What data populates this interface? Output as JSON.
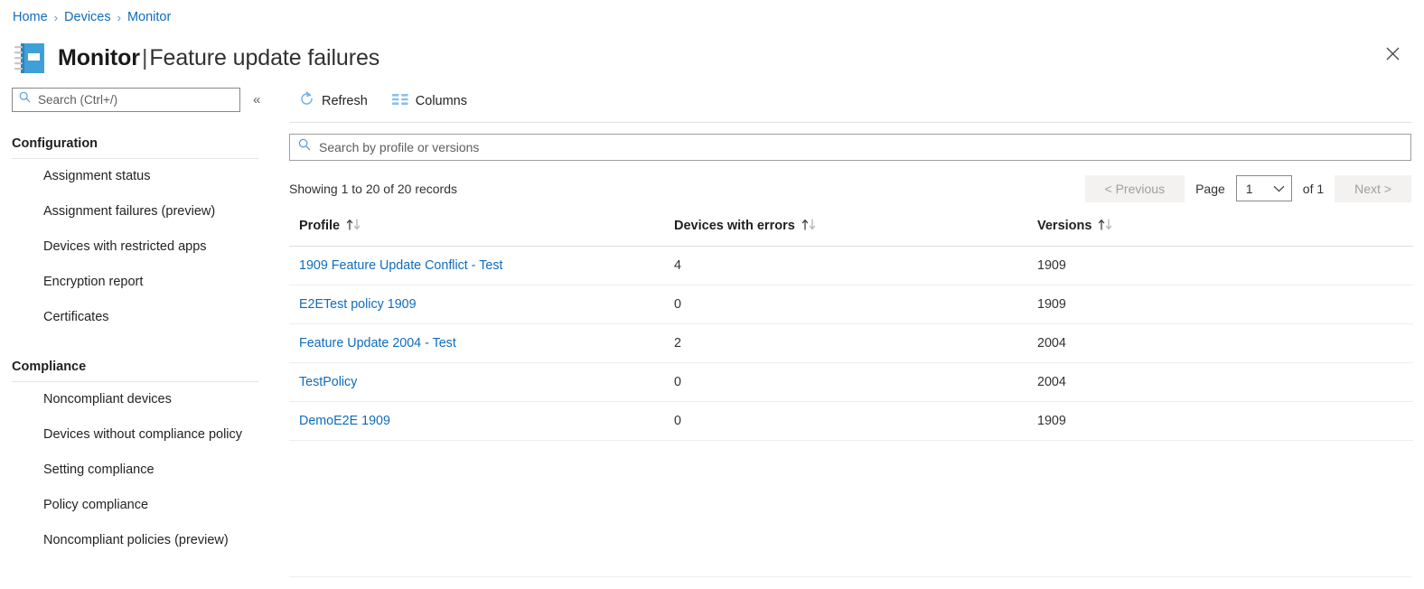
{
  "breadcrumb": {
    "separator": "›",
    "items": [
      {
        "label": "Home"
      },
      {
        "label": "Devices"
      },
      {
        "label": "Monitor"
      }
    ]
  },
  "header": {
    "icon": "notebook-icon",
    "title_bold": "Monitor",
    "title_separator": "|",
    "title_light": "Feature update failures",
    "close_label": "✕"
  },
  "sidebar": {
    "search": {
      "icon": "search-icon",
      "placeholder": "Search (Ctrl+/)",
      "value": ""
    },
    "collapse": {
      "icon": "chevron-double-left-icon",
      "label": "«"
    },
    "groups": [
      {
        "title": "Configuration",
        "items": [
          {
            "icon": "report-icon",
            "label": "Assignment status"
          },
          {
            "icon": "report-icon",
            "label": "Assignment failures (preview)"
          },
          {
            "icon": "report-icon",
            "label": "Devices with restricted apps"
          },
          {
            "icon": "report-icon",
            "label": "Encryption report"
          },
          {
            "icon": "report-icon",
            "label": "Certificates"
          }
        ]
      },
      {
        "title": "Compliance",
        "items": [
          {
            "icon": "report-icon",
            "label": "Noncompliant devices"
          },
          {
            "icon": "report-icon",
            "label": "Devices without compliance policy"
          },
          {
            "icon": "report-icon",
            "label": "Setting compliance"
          },
          {
            "icon": "report-icon",
            "label": "Policy compliance"
          },
          {
            "icon": "report-icon",
            "label": "Noncompliant policies (preview)"
          }
        ]
      }
    ]
  },
  "toolbar": {
    "refresh": {
      "icon": "refresh-icon",
      "label": "Refresh"
    },
    "columns": {
      "icon": "columns-icon",
      "label": "Columns"
    }
  },
  "filter": {
    "icon": "search-icon",
    "placeholder": "Search by profile or versions",
    "value": ""
  },
  "pagination": {
    "records_text": "Showing 1 to 20 of 20 records",
    "previous_label": "< Previous",
    "page_label": "Page",
    "page_value": "1",
    "of_label": "of 1",
    "next_label": "Next >",
    "chevron_icon": "chevron-down-icon"
  },
  "table": {
    "sort_icon": "sort-arrows-icon",
    "columns": [
      {
        "label": "Profile",
        "sortable": true
      },
      {
        "label": "Devices with errors",
        "sortable": true
      },
      {
        "label": "Versions",
        "sortable": true
      }
    ],
    "rows": [
      {
        "profile": "1909 Feature Update Conflict - Test",
        "devices_with_errors": "4",
        "versions": "1909"
      },
      {
        "profile": "E2ETest policy 1909",
        "devices_with_errors": "0",
        "versions": "1909"
      },
      {
        "profile": "Feature Update 2004 - Test",
        "devices_with_errors": "2",
        "versions": "2004"
      },
      {
        "profile": "TestPolicy",
        "devices_with_errors": "0",
        "versions": "2004"
      },
      {
        "profile": "DemoE2E 1909",
        "devices_with_errors": "0",
        "versions": "1909"
      }
    ]
  },
  "colors": {
    "link": "#0f6cbd",
    "icon_blue": "#3fa0d8",
    "icon_blue_dark": "#2b84bd",
    "accent_light_blue": "#8cc0e8",
    "text": "#323130",
    "border": "#e1dfdd"
  }
}
